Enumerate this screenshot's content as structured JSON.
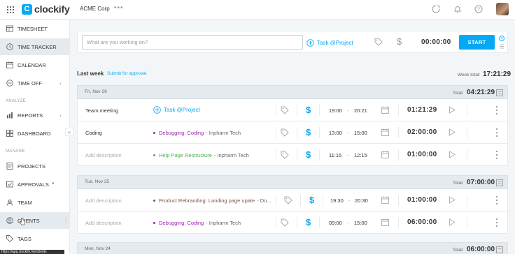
{
  "app": {
    "name": "clockify",
    "workspace": "ACME Corp",
    "workspace_menu": "•••"
  },
  "sidebar": {
    "items": [
      {
        "label": "TIMESHEET",
        "icon": "timesheet-icon"
      },
      {
        "label": "TIME TRACKER",
        "icon": "clock-icon",
        "active": true
      },
      {
        "label": "CALENDAR",
        "icon": "calendar-icon"
      },
      {
        "label": "TIME OFF",
        "icon": "time-off-icon",
        "has_submenu": true
      }
    ],
    "section_analyze": "ANALYZE",
    "analyze_items": [
      {
        "label": "REPORTS",
        "icon": "reports-icon",
        "has_submenu": true
      },
      {
        "label": "DASHBOARD",
        "icon": "dashboard-icon"
      }
    ],
    "section_manage": "MANAGE",
    "manage_items": [
      {
        "label": "PROJECTS",
        "icon": "projects-icon"
      },
      {
        "label": "APPROVALS",
        "icon": "approvals-icon",
        "badge": "•"
      },
      {
        "label": "TEAM",
        "icon": "team-icon"
      },
      {
        "label": "CLIENTS",
        "icon": "clients-icon",
        "hover": true
      },
      {
        "label": "TAGS",
        "icon": "tags-icon"
      }
    ],
    "collapse": "«",
    "status_url": "https://app.clockify.me/clients"
  },
  "timer": {
    "placeholder": "What are you working on?",
    "project_label": "Task @Project",
    "time": "00:00:00",
    "start_label": "START"
  },
  "week": {
    "label": "Last week",
    "submit_label": "Submit for approval",
    "total_label": "Week total:",
    "total": "17:21:29"
  },
  "days": [
    {
      "date": "Fri, Nov 29",
      "total_label": "Total:",
      "total": "04:21:29",
      "entries": [
        {
          "description": "Team meeting",
          "project": "Task @Project",
          "project_is_add": true,
          "client": "",
          "start": "19:00",
          "end": "20:21",
          "duration": "01:21:29"
        },
        {
          "description": "Coding",
          "project": "Debugging: Coding",
          "client": "- Inpharm Tech",
          "color": "#9c27b0",
          "start": "13:00",
          "end": "15:00",
          "duration": "02:00:00"
        },
        {
          "description": "Add description",
          "placeholder": true,
          "project": "Help Page Restructure",
          "client": "- Inpharm Tech",
          "color": "#4caf50",
          "start": "11:15",
          "end": "12:15",
          "duration": "01:00:00"
        }
      ]
    },
    {
      "date": "Tue, Nov 25",
      "total_label": "Total:",
      "total": "07:00:00",
      "entries": [
        {
          "description": "Add description",
          "placeholder": true,
          "project": "Product Rebranding: Landing page upate",
          "client": "- Do...",
          "color": "#795548",
          "start": "19:30",
          "end": "20:30",
          "duration": "01:00:00"
        },
        {
          "description": "Add description",
          "placeholder": true,
          "project": "Debugging: Coding",
          "client": "- Inpharm Tech",
          "color": "#9c27b0",
          "start": "09:00",
          "end": "15:00",
          "duration": "06:00:00"
        }
      ]
    },
    {
      "date": "Mon, Nov 24",
      "total_label": "Total:",
      "total": "06:00:00",
      "entries": []
    }
  ],
  "colors": {
    "accent": "#03a9f4",
    "approvals_badge": "#ff7a00"
  }
}
